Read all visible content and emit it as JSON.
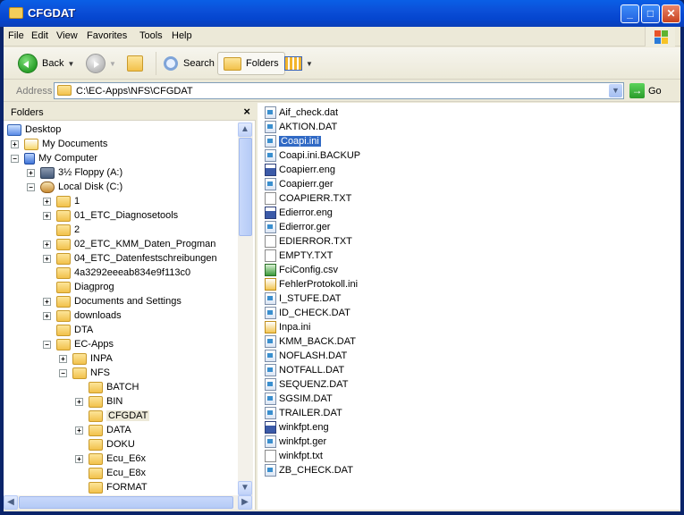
{
  "window": {
    "title": "CFGDAT",
    "controls": {
      "minimize": "_",
      "maximize": "□",
      "close": "✕"
    }
  },
  "menu": [
    "File",
    "Edit",
    "View",
    "Favorites",
    "Tools",
    "Help"
  ],
  "toolbar": {
    "back": "Back",
    "search": "Search",
    "folders": "Folders"
  },
  "address": {
    "label": "Address",
    "value": "C:\\EC-Apps\\NFS\\CFGDAT",
    "go": "Go"
  },
  "folders_pane": {
    "title": "Folders",
    "close": "×",
    "tree": [
      {
        "label": "Desktop",
        "icon": "desktop-icon",
        "level": 0,
        "expander": ""
      },
      {
        "label": "My Documents",
        "icon": "my-documents-icon",
        "level": 1,
        "expander": "+"
      },
      {
        "label": "My Computer",
        "icon": "my-computer-icon",
        "level": 1,
        "expander": "−"
      },
      {
        "label": "3½ Floppy (A:)",
        "icon": "floppy-icon",
        "level": 2,
        "expander": "+"
      },
      {
        "label": "Local Disk (C:)",
        "icon": "local-disk-icon",
        "level": 2,
        "expander": "−"
      },
      {
        "label": "1",
        "icon": "folder-icon",
        "level": 3,
        "expander": "+"
      },
      {
        "label": "01_ETC_Diagnosetools",
        "icon": "shared-folder-icon",
        "level": 3,
        "expander": "+"
      },
      {
        "label": "2",
        "icon": "folder-icon",
        "level": 3,
        "expander": ""
      },
      {
        "label": "02_ETC_KMM_Daten_Progman",
        "icon": "shared-folder-icon",
        "level": 3,
        "expander": "+"
      },
      {
        "label": "04_ETC_Datenfestschreibungen",
        "icon": "shared-folder-icon",
        "level": 3,
        "expander": "+"
      },
      {
        "label": "4a3292eeeab834e9f113c0",
        "icon": "folder-icon",
        "level": 3,
        "expander": ""
      },
      {
        "label": "Diagprog",
        "icon": "folder-icon",
        "level": 3,
        "expander": ""
      },
      {
        "label": "Documents and Settings",
        "icon": "folder-icon",
        "level": 3,
        "expander": "+"
      },
      {
        "label": "downloads",
        "icon": "shared-folder-icon",
        "level": 3,
        "expander": "+"
      },
      {
        "label": "DTA",
        "icon": "folder-icon",
        "level": 3,
        "expander": ""
      },
      {
        "label": "EC-Apps",
        "icon": "shared-folder-icon",
        "level": 3,
        "expander": "−"
      },
      {
        "label": "INPA",
        "icon": "folder-icon",
        "level": 4,
        "expander": "+"
      },
      {
        "label": "NFS",
        "icon": "folder-icon",
        "level": 4,
        "expander": "−"
      },
      {
        "label": "BATCH",
        "icon": "folder-icon",
        "level": 5,
        "expander": ""
      },
      {
        "label": "BIN",
        "icon": "folder-icon",
        "level": 5,
        "expander": "+"
      },
      {
        "label": "CFGDAT",
        "icon": "open-folder-icon",
        "level": 5,
        "expander": "",
        "selected": true
      },
      {
        "label": "DATA",
        "icon": "folder-icon",
        "level": 5,
        "expander": "+"
      },
      {
        "label": "DOKU",
        "icon": "folder-icon",
        "level": 5,
        "expander": ""
      },
      {
        "label": "Ecu_E6x",
        "icon": "folder-icon",
        "level": 5,
        "expander": "+"
      },
      {
        "label": "Ecu_E8x",
        "icon": "folder-icon",
        "level": 5,
        "expander": ""
      },
      {
        "label": "FORMAT",
        "icon": "folder-icon",
        "level": 5,
        "expander": ""
      }
    ]
  },
  "files": [
    {
      "name": "Aif_check.dat",
      "type": "dat"
    },
    {
      "name": "AKTION.DAT",
      "type": "dat"
    },
    {
      "name": "Coapi.ini",
      "type": "dat",
      "selected": true
    },
    {
      "name": "Coapi.ini.BACKUP",
      "type": "dat"
    },
    {
      "name": "Coapierr.eng",
      "type": "eng"
    },
    {
      "name": "Coapierr.ger",
      "type": "dat"
    },
    {
      "name": "COAPIERR.TXT",
      "type": "txt"
    },
    {
      "name": "Edierror.eng",
      "type": "eng"
    },
    {
      "name": "Edierror.ger",
      "type": "dat"
    },
    {
      "name": "EDIERROR.TXT",
      "type": "txt"
    },
    {
      "name": "EMPTY.TXT",
      "type": "txt"
    },
    {
      "name": "FciConfig.csv",
      "type": "csv"
    },
    {
      "name": "FehlerProtokoll.ini",
      "type": "ini"
    },
    {
      "name": "I_STUFE.DAT",
      "type": "dat"
    },
    {
      "name": "ID_CHECK.DAT",
      "type": "dat"
    },
    {
      "name": "Inpa.ini",
      "type": "ini"
    },
    {
      "name": "KMM_BACK.DAT",
      "type": "dat"
    },
    {
      "name": "NOFLASH.DAT",
      "type": "dat"
    },
    {
      "name": "NOTFALL.DAT",
      "type": "dat"
    },
    {
      "name": "SEQUENZ.DAT",
      "type": "dat"
    },
    {
      "name": "SGSIM.DAT",
      "type": "dat"
    },
    {
      "name": "TRAILER.DAT",
      "type": "dat"
    },
    {
      "name": "winkfpt.eng",
      "type": "eng"
    },
    {
      "name": "winkfpt.ger",
      "type": "dat"
    },
    {
      "name": "winkfpt.txt",
      "type": "txt"
    },
    {
      "name": "ZB_CHECK.DAT",
      "type": "dat"
    }
  ]
}
